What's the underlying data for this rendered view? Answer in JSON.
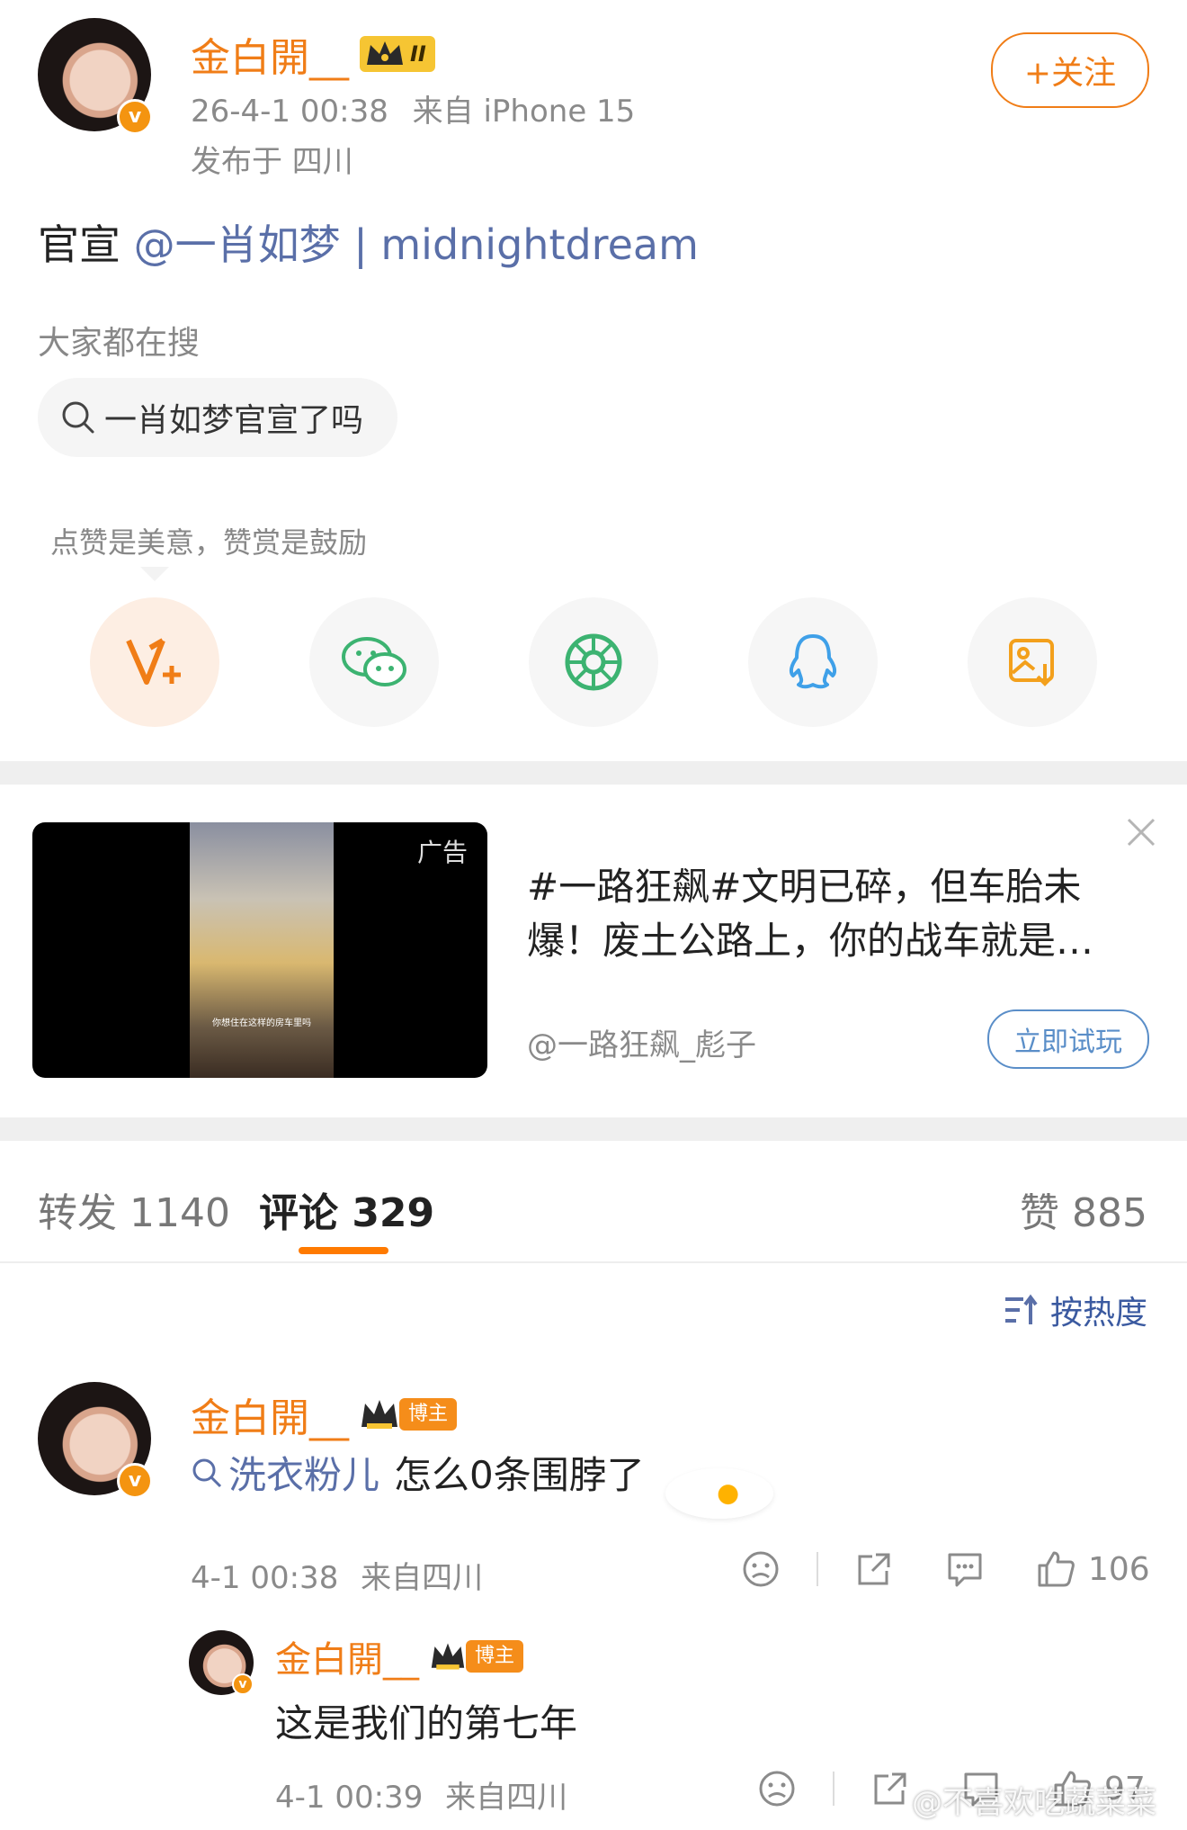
{
  "post": {
    "author": "金白開__",
    "level_badge": "II",
    "timestamp": "26-4-1 00:38",
    "source": "来自 iPhone 15",
    "location": "发布于 四川",
    "follow_label": "+关注",
    "content_prefix": "官宣",
    "mention": "@一肖如梦 | midnightdream"
  },
  "search_suggest": {
    "heading": "大家都在搜",
    "query": "一肖如梦官宣了吗"
  },
  "share": {
    "tip": "点赞是美意，赞赏是鼓励",
    "icons": [
      "reward-icon",
      "wechat-icon",
      "moments-icon",
      "qq-icon",
      "save-image-icon"
    ]
  },
  "ad": {
    "tag": "广告",
    "caption": "你想住在这样的房车里吗",
    "text_line1": "#一路狂飙#文明已碎，但车胎未",
    "text_line2": "爆！废土公路上，你的战车就是…",
    "account": "@一路狂飙_彪子",
    "cta": "立即试玩"
  },
  "tabs": {
    "repost": "转发 1140",
    "comment": "评论 329",
    "like": "赞 885"
  },
  "sort_label": "按热度",
  "comments": [
    {
      "author": "金白開__",
      "badge": "博主",
      "search_link": "洗衣粉儿",
      "text": "怎么0条围脖了",
      "time": "4-1 00:38",
      "location": "来自四川",
      "likes": "106"
    },
    {
      "author": "金白開__",
      "badge": "博主",
      "text": "这是我们的第七年",
      "time": "4-1 00:39",
      "location": "来自四川",
      "likes": "97"
    }
  ],
  "watermark": "@不喜欢吃蔬菜菜",
  "colors": {
    "accent_orange": "#f07d17",
    "link_blue": "#5a6fa8",
    "tab_indicator": "#ff7a00"
  }
}
